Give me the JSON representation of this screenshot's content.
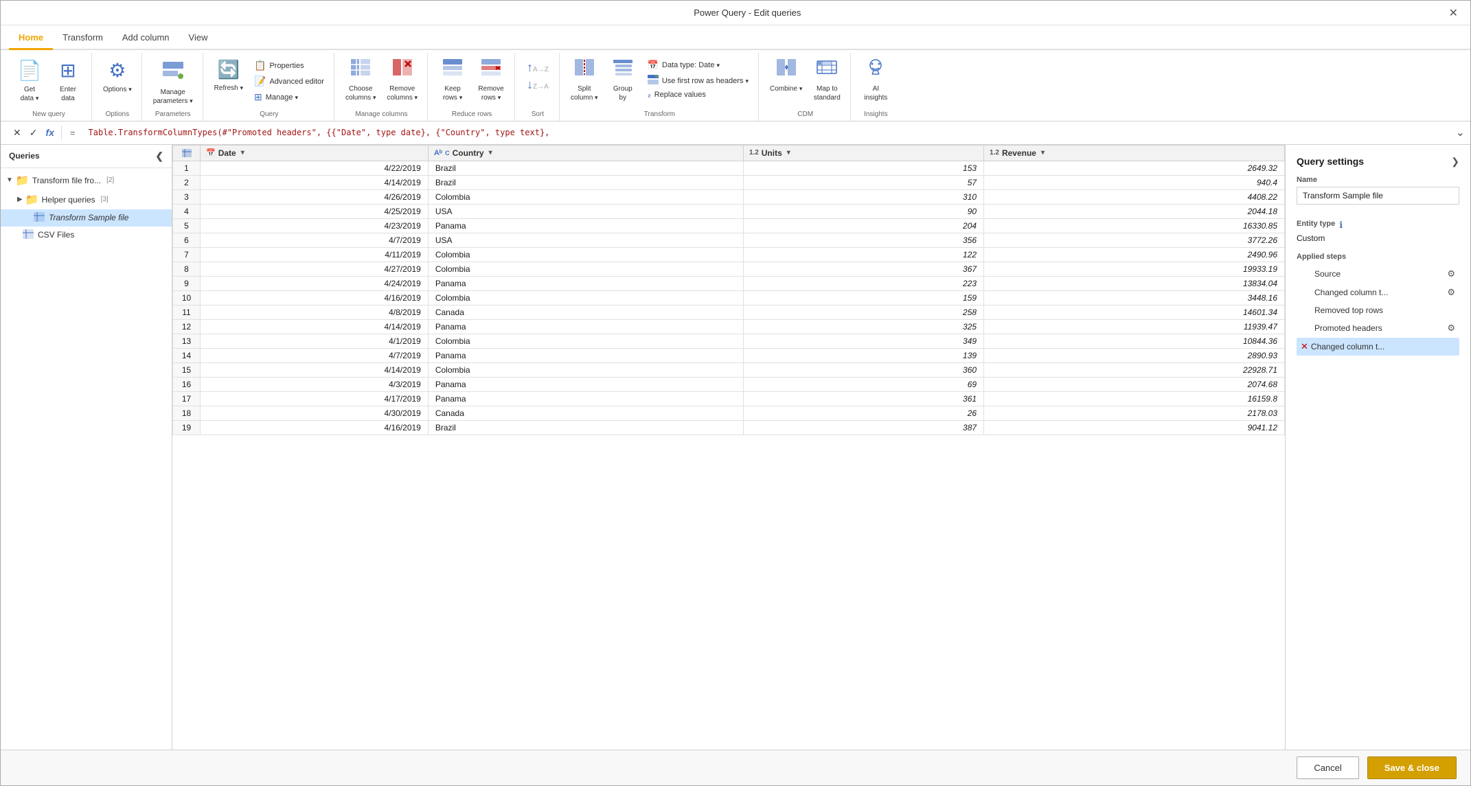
{
  "titlebar": {
    "title": "Power Query - Edit queries",
    "close_label": "✕"
  },
  "ribbon_tabs": [
    {
      "label": "Home",
      "active": true
    },
    {
      "label": "Transform",
      "active": false
    },
    {
      "label": "Add column",
      "active": false
    },
    {
      "label": "View",
      "active": false
    }
  ],
  "ribbon": {
    "groups": [
      {
        "name": "new-query",
        "label": "New query",
        "items": [
          {
            "id": "get-data",
            "icon": "📄",
            "label": "Get\ndata ▾",
            "large": true
          },
          {
            "id": "enter-data",
            "icon": "⊞",
            "label": "Enter\ndata",
            "large": true
          }
        ]
      },
      {
        "name": "options",
        "label": "Options",
        "items": [
          {
            "id": "options-btn",
            "icon": "⚙",
            "label": "Options\n▾",
            "large": true
          }
        ]
      },
      {
        "name": "parameters",
        "label": "Parameters",
        "items": [
          {
            "id": "manage-params",
            "icon": "⊞",
            "label": "Manage\nparameters ▾",
            "large": true
          }
        ]
      },
      {
        "name": "query",
        "label": "Query",
        "items_stack": [
          {
            "id": "properties",
            "icon": "📋",
            "label": "Properties"
          },
          {
            "id": "advanced-editor",
            "icon": "📝",
            "label": "Advanced editor"
          },
          {
            "id": "manage",
            "icon": "⊞",
            "label": "Manage ▾"
          }
        ],
        "items": [
          {
            "id": "refresh",
            "icon": "🔄",
            "label": "Refresh\n▾",
            "large": true
          }
        ]
      },
      {
        "name": "manage-columns",
        "label": "Manage columns",
        "items": [
          {
            "id": "choose-columns",
            "icon": "⊞",
            "label": "Choose\ncolumns ▾",
            "large": true
          },
          {
            "id": "remove-columns",
            "icon": "✕",
            "label": "Remove\ncolumns ▾",
            "large": true,
            "icon_color": "red"
          }
        ]
      },
      {
        "name": "reduce-rows",
        "label": "Reduce rows",
        "items": [
          {
            "id": "keep-rows",
            "icon": "⊞",
            "label": "Keep\nrows ▾",
            "large": true
          },
          {
            "id": "remove-rows",
            "icon": "✕",
            "label": "Remove\nrows ▾",
            "large": true,
            "icon_color": "red"
          }
        ]
      },
      {
        "name": "sort",
        "label": "Sort",
        "items": [
          {
            "id": "sort-asc",
            "icon": "↑",
            "label": ""
          },
          {
            "id": "sort-desc",
            "icon": "↓",
            "label": ""
          }
        ]
      },
      {
        "name": "transform",
        "label": "Transform",
        "items_stack": [
          {
            "id": "data-type",
            "icon": "📅",
            "label": "Data type: Date ▾"
          },
          {
            "id": "first-row-headers",
            "icon": "⊞",
            "label": "Use first row as headers ▾"
          },
          {
            "id": "replace-values",
            "icon": "🔁",
            "label": "₂ Replace values"
          }
        ],
        "items": [
          {
            "id": "split-column",
            "icon": "⊞",
            "label": "Split\ncolumn ▾",
            "large": true
          },
          {
            "id": "group-by",
            "icon": "⊞",
            "label": "Group\nby",
            "large": true
          }
        ]
      },
      {
        "name": "cdm",
        "label": "CDM",
        "items": [
          {
            "id": "combine",
            "icon": "⊞",
            "label": "Combine\n▾",
            "large": true
          },
          {
            "id": "map-to-standard",
            "icon": "⊞",
            "label": "Map to\nstandard",
            "large": true
          }
        ]
      },
      {
        "name": "insights",
        "label": "Insights",
        "items": [
          {
            "id": "ai-insights",
            "icon": "🤖",
            "label": "AI\ninsights",
            "large": true
          }
        ]
      }
    ]
  },
  "formula_bar": {
    "cancel_icon": "✕",
    "confirm_icon": "✓",
    "fx_label": "fx",
    "eq_label": "=",
    "formula": "Table.TransformColumnTypes(#\"Promoted headers\", {{\"Date\", type date}, {\"Country\", type text},",
    "expand_icon": "⌄"
  },
  "queries_panel": {
    "title": "Queries",
    "collapse_icon": "❮",
    "items": [
      {
        "id": "transform-file",
        "type": "group",
        "icon": "📁",
        "name": "Transform file fro...",
        "count": "[2]",
        "expanded": true,
        "indent": 0
      },
      {
        "id": "helper-queries",
        "type": "group",
        "icon": "📁",
        "name": "Helper queries",
        "count": "[3]",
        "expanded": false,
        "indent": 1
      },
      {
        "id": "transform-sample",
        "type": "query",
        "icon": "⊞",
        "name": "Transform Sample file",
        "selected": true,
        "indent": 2
      },
      {
        "id": "csv-files",
        "type": "query",
        "icon": "⊞",
        "name": "CSV Files",
        "selected": false,
        "indent": 1
      }
    ]
  },
  "grid": {
    "column_header_icon": "⊞",
    "columns": [
      {
        "id": "date",
        "type_icon": "📅",
        "type_label": "Date",
        "name": "Date"
      },
      {
        "id": "country",
        "type_icon": "Aᵇ",
        "type_label": "ABC",
        "name": "Country"
      },
      {
        "id": "units",
        "type_icon": "1.2",
        "type_label": "1.2",
        "name": "Units"
      },
      {
        "id": "revenue",
        "type_icon": "1.2",
        "type_label": "1.2",
        "name": "Revenue"
      }
    ],
    "rows": [
      {
        "num": 1,
        "date": "4/22/2019",
        "country": "Brazil",
        "units": "153",
        "revenue": "2649.32"
      },
      {
        "num": 2,
        "date": "4/14/2019",
        "country": "Brazil",
        "units": "57",
        "revenue": "940.4"
      },
      {
        "num": 3,
        "date": "4/26/2019",
        "country": "Colombia",
        "units": "310",
        "revenue": "4408.22"
      },
      {
        "num": 4,
        "date": "4/25/2019",
        "country": "USA",
        "units": "90",
        "revenue": "2044.18"
      },
      {
        "num": 5,
        "date": "4/23/2019",
        "country": "Panama",
        "units": "204",
        "revenue": "16330.85"
      },
      {
        "num": 6,
        "date": "4/7/2019",
        "country": "USA",
        "units": "356",
        "revenue": "3772.26"
      },
      {
        "num": 7,
        "date": "4/11/2019",
        "country": "Colombia",
        "units": "122",
        "revenue": "2490.96"
      },
      {
        "num": 8,
        "date": "4/27/2019",
        "country": "Colombia",
        "units": "367",
        "revenue": "19933.19"
      },
      {
        "num": 9,
        "date": "4/24/2019",
        "country": "Panama",
        "units": "223",
        "revenue": "13834.04"
      },
      {
        "num": 10,
        "date": "4/16/2019",
        "country": "Colombia",
        "units": "159",
        "revenue": "3448.16"
      },
      {
        "num": 11,
        "date": "4/8/2019",
        "country": "Canada",
        "units": "258",
        "revenue": "14601.34"
      },
      {
        "num": 12,
        "date": "4/14/2019",
        "country": "Panama",
        "units": "325",
        "revenue": "11939.47"
      },
      {
        "num": 13,
        "date": "4/1/2019",
        "country": "Colombia",
        "units": "349",
        "revenue": "10844.36"
      },
      {
        "num": 14,
        "date": "4/7/2019",
        "country": "Panama",
        "units": "139",
        "revenue": "2890.93"
      },
      {
        "num": 15,
        "date": "4/14/2019",
        "country": "Colombia",
        "units": "360",
        "revenue": "22928.71"
      },
      {
        "num": 16,
        "date": "4/3/2019",
        "country": "Panama",
        "units": "69",
        "revenue": "2074.68"
      },
      {
        "num": 17,
        "date": "4/17/2019",
        "country": "Panama",
        "units": "361",
        "revenue": "16159.8"
      },
      {
        "num": 18,
        "date": "4/30/2019",
        "country": "Canada",
        "units": "26",
        "revenue": "2178.03"
      },
      {
        "num": 19,
        "date": "4/16/2019",
        "country": "Brazil",
        "units": "387",
        "revenue": "9041.12"
      }
    ]
  },
  "query_settings": {
    "title": "Query settings",
    "expand_icon": "❯",
    "name_label": "Name",
    "name_value": "Transform Sample file",
    "entity_type_label": "Entity type",
    "info_icon": "ℹ",
    "entity_value": "Custom",
    "applied_steps_label": "Applied steps",
    "steps": [
      {
        "id": "source",
        "label": "Source",
        "has_gear": true,
        "has_x": false,
        "active": false
      },
      {
        "id": "changed-col-t1",
        "label": "Changed column t...",
        "has_gear": true,
        "has_x": false,
        "active": false
      },
      {
        "id": "removed-top",
        "label": "Removed top rows",
        "has_gear": false,
        "has_x": false,
        "active": false
      },
      {
        "id": "promoted-headers",
        "label": "Promoted headers",
        "has_gear": true,
        "has_x": false,
        "active": false
      },
      {
        "id": "changed-col-t2",
        "label": "Changed column t...",
        "has_gear": false,
        "has_x": true,
        "active": true
      }
    ]
  },
  "bottom_bar": {
    "cancel_label": "Cancel",
    "save_label": "Save & close"
  }
}
